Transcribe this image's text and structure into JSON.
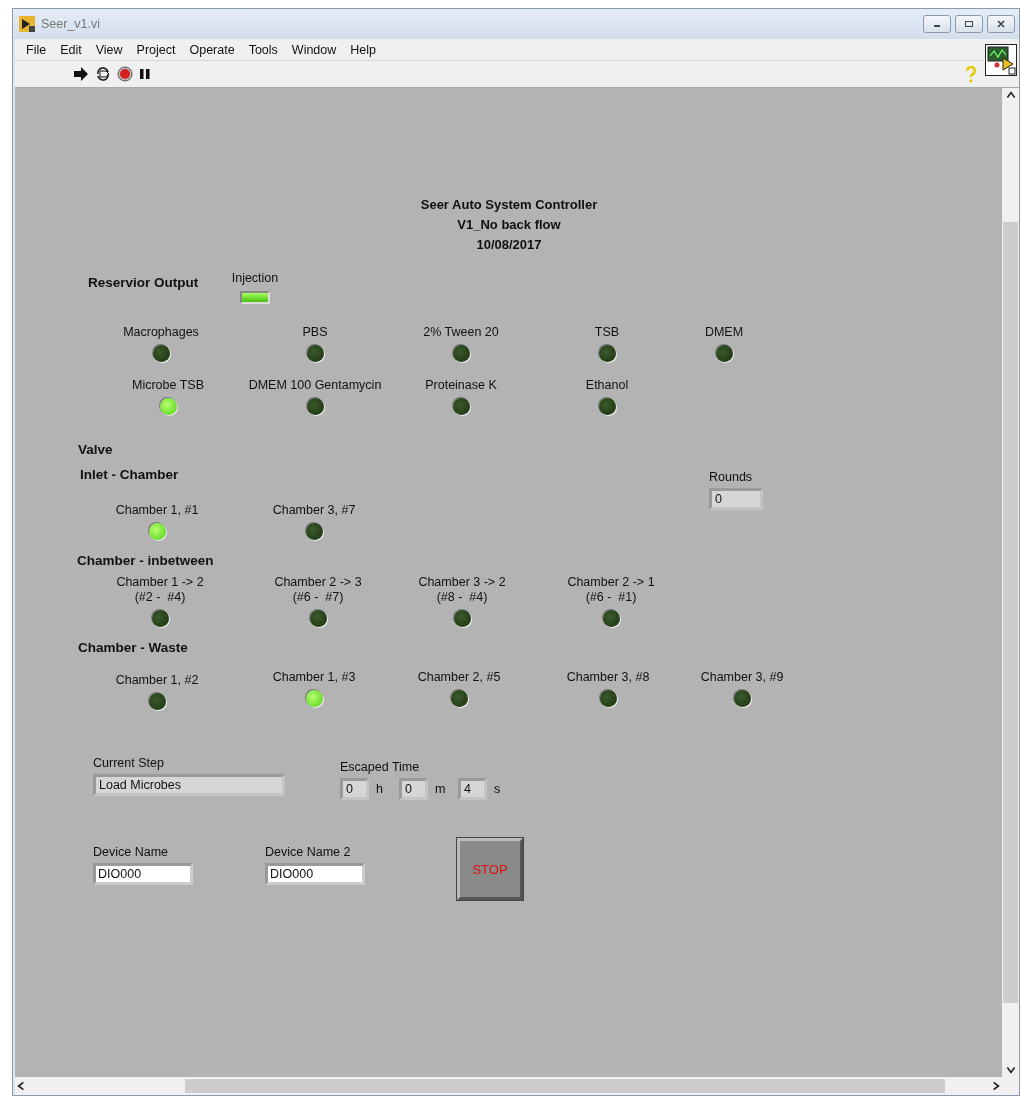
{
  "window": {
    "title": "Seer_v1.vi"
  },
  "menu": [
    "File",
    "Edit",
    "View",
    "Project",
    "Operate",
    "Tools",
    "Window",
    "Help"
  ],
  "panel": {
    "heading": [
      "Seer Auto System Controller",
      "V1_No back flow",
      "10/08/2017"
    ],
    "sections": [
      {
        "title": "Reservior Output",
        "indicators": [
          {
            "label": "Injection",
            "on": true,
            "kind": "bar"
          },
          {
            "label": "Macrophages",
            "on": false,
            "kind": "round"
          },
          {
            "label": "PBS",
            "on": false,
            "kind": "round"
          },
          {
            "label": "2% Tween 20",
            "on": false,
            "kind": "round"
          },
          {
            "label": "TSB",
            "on": false,
            "kind": "round"
          },
          {
            "label": "DMEM",
            "on": false,
            "kind": "round"
          },
          {
            "label": "Microbe TSB",
            "on": true,
            "kind": "round"
          },
          {
            "label": "DMEM 100 Gentamycin",
            "on": false,
            "kind": "round"
          },
          {
            "label": "Proteinase K",
            "on": false,
            "kind": "round"
          },
          {
            "label": "Ethanol",
            "on": false,
            "kind": "round"
          }
        ]
      },
      {
        "title": "Valve"
      },
      {
        "title": "Inlet - Chamber",
        "indicators": [
          {
            "label": "Chamber 1, #1",
            "on": true,
            "kind": "round"
          },
          {
            "label": "Chamber 3, #7",
            "on": false,
            "kind": "round"
          }
        ]
      },
      {
        "title": "Chamber - inbetween",
        "indicators": [
          {
            "label": "Chamber 1 -> 2\n(#2 -  #4)",
            "on": false,
            "kind": "round"
          },
          {
            "label": "Chamber 2 -> 3\n(#6 -  #7)",
            "on": false,
            "kind": "round"
          },
          {
            "label": "Chamber 3 -> 2\n(#8 -  #4)",
            "on": false,
            "kind": "round"
          },
          {
            "label": "Chamber 2 -> 1\n(#6 -  #1)",
            "on": false,
            "kind": "round"
          }
        ]
      },
      {
        "title": "Chamber - Waste",
        "indicators": [
          {
            "label": "Chamber 1, #2",
            "on": false,
            "kind": "round"
          },
          {
            "label": "Chamber 1, #3",
            "on": true,
            "kind": "round"
          },
          {
            "label": "Chamber 2, #5",
            "on": false,
            "kind": "round"
          },
          {
            "label": "Chamber 3, #8",
            "on": false,
            "kind": "round"
          },
          {
            "label": "Chamber 3, #9",
            "on": false,
            "kind": "round"
          }
        ]
      }
    ],
    "rounds": {
      "label": "Rounds",
      "value": "0"
    },
    "current_step": {
      "label": "Current Step",
      "value": "Load Microbes"
    },
    "escaped_time": {
      "label": "Escaped Time",
      "fields": [
        {
          "value": "0",
          "unit": "h"
        },
        {
          "value": "0",
          "unit": "m"
        },
        {
          "value": "4",
          "unit": "s"
        }
      ]
    },
    "devices": [
      {
        "label": "Device Name",
        "value": "DIO000"
      },
      {
        "label": "Device Name 2",
        "value": "DIO000"
      }
    ],
    "stop_button": {
      "label": "STOP"
    }
  }
}
